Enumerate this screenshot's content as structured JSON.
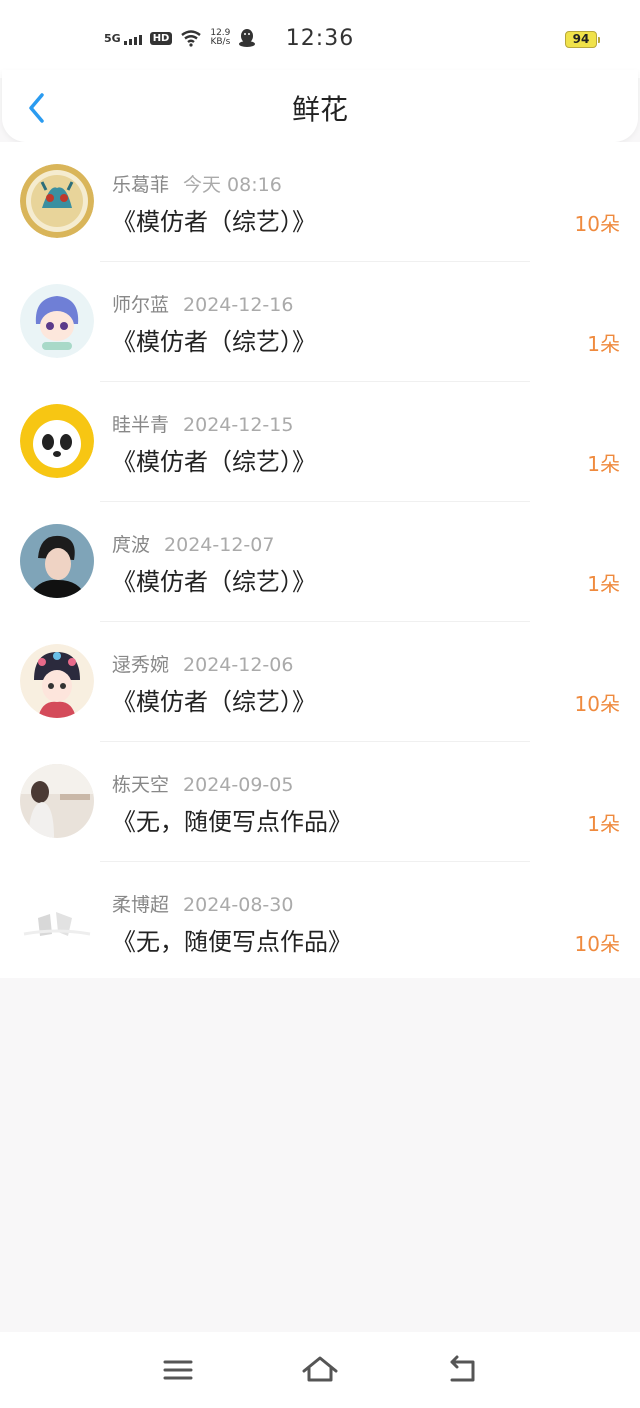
{
  "status_bar": {
    "network": "5G",
    "hd": "HD",
    "speed_value": "12.9",
    "speed_unit": "KB/s",
    "time": "12:36",
    "battery": "94",
    "icons": [
      "signal-icon",
      "hd-icon",
      "wifi-icon",
      "qq-icon"
    ]
  },
  "header": {
    "title": "鲜花",
    "back_icon": "chevron-left-icon"
  },
  "flowers": [
    {
      "name": "乐葛菲",
      "date": "今天 08:16",
      "work": "《模仿者（综艺）》",
      "count": "10朵",
      "avatar": "zodiac-medal-avatar"
    },
    {
      "name": "师尔蓝",
      "date": "2024-12-16",
      "work": "《模仿者（综艺）》",
      "count": "1朵",
      "avatar": "anime-girl-avatar"
    },
    {
      "name": "眭半青",
      "date": "2024-12-15",
      "work": "《模仿者（综艺）》",
      "count": "1朵",
      "avatar": "panda-sunflower-avatar"
    },
    {
      "name": "庹波",
      "date": "2024-12-07",
      "work": "《模仿者（综艺）》",
      "count": "1朵",
      "avatar": "young-man-avatar"
    },
    {
      "name": "逯秀婉",
      "date": "2024-12-06",
      "work": "《模仿者（综艺）》",
      "count": "10朵",
      "avatar": "opera-girl-avatar"
    },
    {
      "name": "栋天空",
      "date": "2024-09-05",
      "work": "《无，随便写点作品》",
      "count": "1朵",
      "avatar": "photo-girl-avatar"
    },
    {
      "name": "柔博超",
      "date": "2024-08-30",
      "work": "《无，随便写点作品》",
      "count": "10朵",
      "avatar": "sketch-avatar"
    }
  ],
  "nav": {
    "menu_icon": "menu-icon",
    "home_icon": "home-icon",
    "back_icon": "back-arrow-icon"
  },
  "colors": {
    "accent_blue": "#2a9bf0",
    "count_orange": "#ef8a3e",
    "battery_yellow": "#f0e24a"
  }
}
